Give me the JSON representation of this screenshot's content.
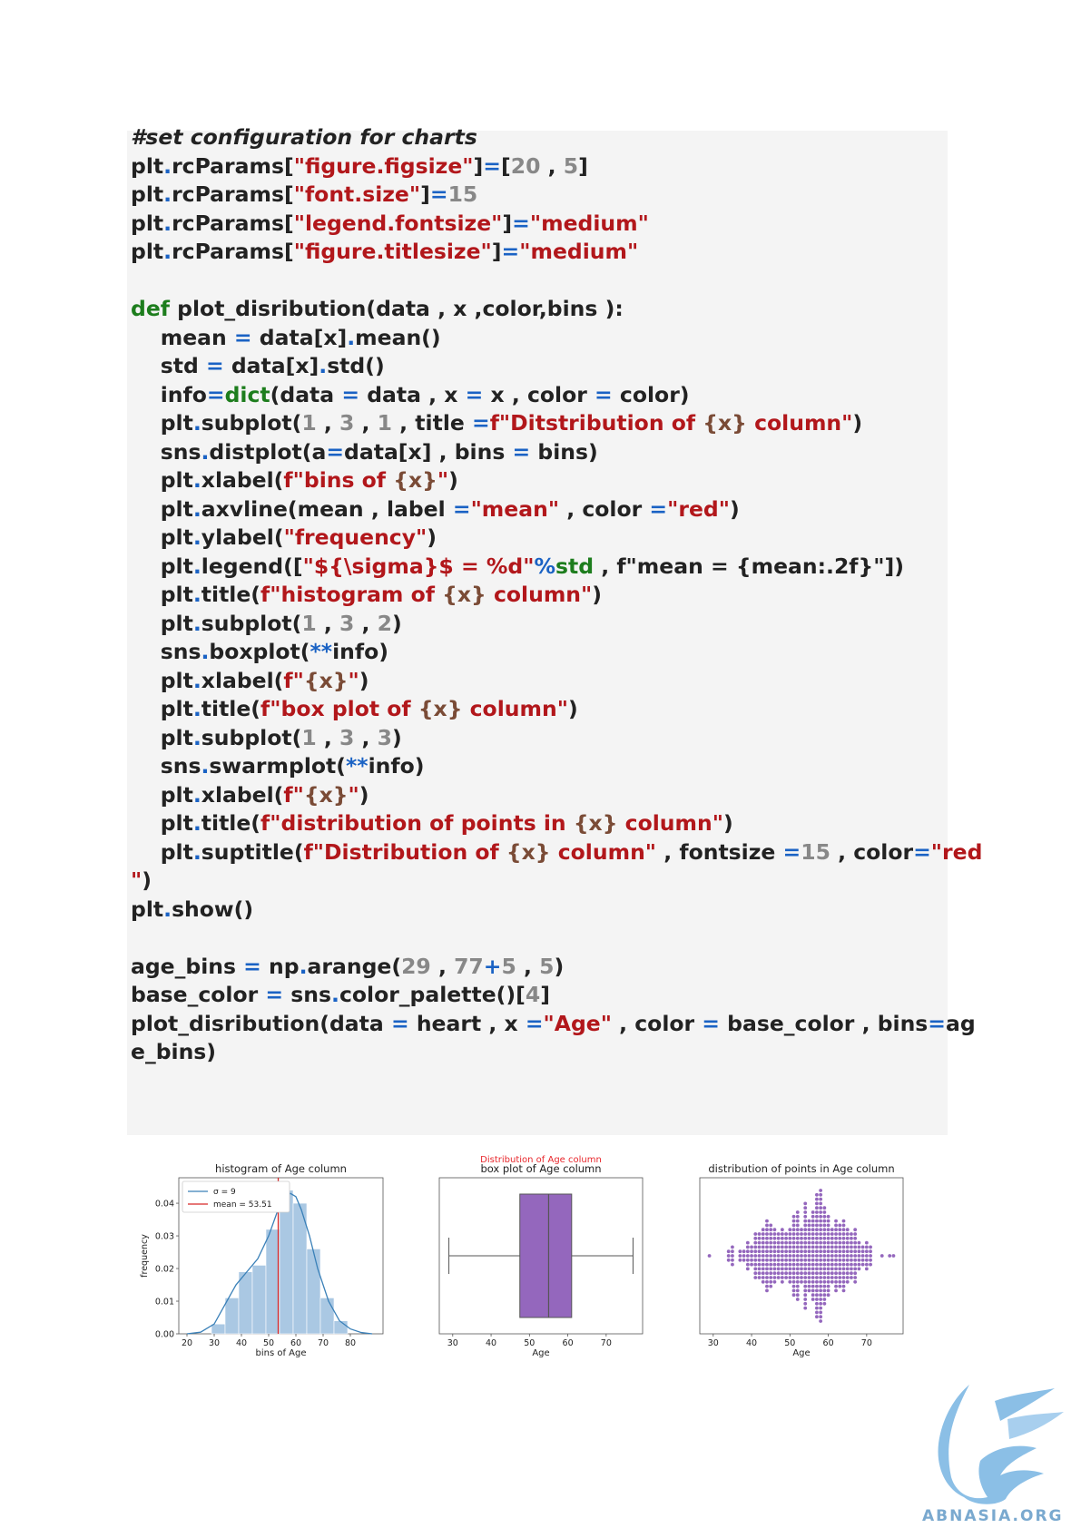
{
  "colors": {
    "code_default": "#222222",
    "code_keyword": "#1d7d1d",
    "code_string": "#b2171b",
    "code_number": "#888888",
    "code_operator": "#1a62c4",
    "code_fstring_brace": "#7a4b36",
    "code_block_bg": "#f4f4f4",
    "hist_fill": "#aac8e3",
    "kde_line": "#3a80b8",
    "mean_line": "#d62728",
    "box_fill": "#9467bd",
    "swarm_point": "#9467bd",
    "suptitle": "#e8262b",
    "logo": "#8bbfe6"
  },
  "code": {
    "lines": [
      [
        {
          "t": "#set configuration for charts",
          "c": "cm"
        }
      ],
      [
        {
          "t": "plt",
          "c": "d"
        },
        {
          "t": ".",
          "c": "o"
        },
        {
          "t": "rcParams[",
          "c": "d"
        },
        {
          "t": "\"figure.figsize\"",
          "c": "s"
        },
        {
          "t": "]",
          "c": "d"
        },
        {
          "t": "=",
          "c": "o"
        },
        {
          "t": "[",
          "c": "d"
        },
        {
          "t": "20",
          "c": "n"
        },
        {
          "t": " , ",
          "c": "d"
        },
        {
          "t": "5",
          "c": "n"
        },
        {
          "t": "]",
          "c": "d"
        }
      ],
      [
        {
          "t": "plt",
          "c": "d"
        },
        {
          "t": ".",
          "c": "o"
        },
        {
          "t": "rcParams[",
          "c": "d"
        },
        {
          "t": "\"font.size\"",
          "c": "s"
        },
        {
          "t": "]",
          "c": "d"
        },
        {
          "t": "=",
          "c": "o"
        },
        {
          "t": "15",
          "c": "n"
        }
      ],
      [
        {
          "t": "plt",
          "c": "d"
        },
        {
          "t": ".",
          "c": "o"
        },
        {
          "t": "rcParams[",
          "c": "d"
        },
        {
          "t": "\"legend.fontsize\"",
          "c": "s"
        },
        {
          "t": "]",
          "c": "d"
        },
        {
          "t": "=",
          "c": "o"
        },
        {
          "t": "\"medium\"",
          "c": "s"
        }
      ],
      [
        {
          "t": "plt",
          "c": "d"
        },
        {
          "t": ".",
          "c": "o"
        },
        {
          "t": "rcParams[",
          "c": "d"
        },
        {
          "t": "\"figure.titlesize\"",
          "c": "s"
        },
        {
          "t": "]",
          "c": "d"
        },
        {
          "t": "=",
          "c": "o"
        },
        {
          "t": "\"medium\"",
          "c": "s"
        }
      ],
      [],
      [
        {
          "t": "def",
          "c": "k"
        },
        {
          "t": " plot_disribution(data , x ,color,bins ):",
          "c": "d"
        }
      ],
      [
        {
          "t": "    mean ",
          "c": "d"
        },
        {
          "t": "=",
          "c": "o"
        },
        {
          "t": " data[x]",
          "c": "d"
        },
        {
          "t": ".",
          "c": "o"
        },
        {
          "t": "mean()",
          "c": "d"
        }
      ],
      [
        {
          "t": "    std ",
          "c": "d"
        },
        {
          "t": "=",
          "c": "o"
        },
        {
          "t": " data[x]",
          "c": "d"
        },
        {
          "t": ".",
          "c": "o"
        },
        {
          "t": "std()",
          "c": "d"
        }
      ],
      [
        {
          "t": "    info",
          "c": "d"
        },
        {
          "t": "=",
          "c": "o"
        },
        {
          "t": "dict",
          "c": "k"
        },
        {
          "t": "(data ",
          "c": "d"
        },
        {
          "t": "=",
          "c": "o"
        },
        {
          "t": " data , x ",
          "c": "d"
        },
        {
          "t": "=",
          "c": "o"
        },
        {
          "t": " x , color ",
          "c": "d"
        },
        {
          "t": "=",
          "c": "o"
        },
        {
          "t": " color)",
          "c": "d"
        }
      ],
      [
        {
          "t": "    plt",
          "c": "d"
        },
        {
          "t": ".",
          "c": "o"
        },
        {
          "t": "subplot(",
          "c": "d"
        },
        {
          "t": "1",
          "c": "n"
        },
        {
          "t": " , ",
          "c": "d"
        },
        {
          "t": "3",
          "c": "n"
        },
        {
          "t": " , ",
          "c": "d"
        },
        {
          "t": "1",
          "c": "n"
        },
        {
          "t": " , title ",
          "c": "d"
        },
        {
          "t": "=",
          "c": "o"
        },
        {
          "t": "f\"Ditstribution of ",
          "c": "s"
        },
        {
          "t": "{x}",
          "c": "b"
        },
        {
          "t": " column\"",
          "c": "s"
        },
        {
          "t": ")",
          "c": "d"
        }
      ],
      [
        {
          "t": "    sns",
          "c": "d"
        },
        {
          "t": ".",
          "c": "o"
        },
        {
          "t": "distplot(a",
          "c": "d"
        },
        {
          "t": "=",
          "c": "o"
        },
        {
          "t": "data[x] , bins ",
          "c": "d"
        },
        {
          "t": "=",
          "c": "o"
        },
        {
          "t": " bins)",
          "c": "d"
        }
      ],
      [
        {
          "t": "    plt",
          "c": "d"
        },
        {
          "t": ".",
          "c": "o"
        },
        {
          "t": "xlabel(",
          "c": "d"
        },
        {
          "t": "f\"bins of ",
          "c": "s"
        },
        {
          "t": "{x}",
          "c": "b"
        },
        {
          "t": "\"",
          "c": "s"
        },
        {
          "t": ")",
          "c": "d"
        }
      ],
      [
        {
          "t": "    plt",
          "c": "d"
        },
        {
          "t": ".",
          "c": "o"
        },
        {
          "t": "axvline(mean , label ",
          "c": "d"
        },
        {
          "t": "=",
          "c": "o"
        },
        {
          "t": "\"mean\"",
          "c": "s"
        },
        {
          "t": " , color ",
          "c": "d"
        },
        {
          "t": "=",
          "c": "o"
        },
        {
          "t": "\"red\"",
          "c": "s"
        },
        {
          "t": ")",
          "c": "d"
        }
      ],
      [
        {
          "t": "    plt",
          "c": "d"
        },
        {
          "t": ".",
          "c": "o"
        },
        {
          "t": "ylabel(",
          "c": "d"
        },
        {
          "t": "\"frequency\"",
          "c": "s"
        },
        {
          "t": ")",
          "c": "d"
        }
      ],
      [
        {
          "t": "    plt",
          "c": "d"
        },
        {
          "t": ".",
          "c": "o"
        },
        {
          "t": "legend([",
          "c": "d"
        },
        {
          "t": "\"${\\sigma}$ = %d\"",
          "c": "s"
        },
        {
          "t": "%",
          "c": "o"
        },
        {
          "t": "std",
          "c": "k"
        },
        {
          "t": " , f\"mean = {mean:.2f}\"])",
          "c": "d"
        }
      ],
      [
        {
          "t": "    plt",
          "c": "d"
        },
        {
          "t": ".",
          "c": "o"
        },
        {
          "t": "title(",
          "c": "d"
        },
        {
          "t": "f\"histogram of ",
          "c": "s"
        },
        {
          "t": "{x}",
          "c": "b"
        },
        {
          "t": " column\"",
          "c": "s"
        },
        {
          "t": ")",
          "c": "d"
        }
      ],
      [
        {
          "t": "    plt",
          "c": "d"
        },
        {
          "t": ".",
          "c": "o"
        },
        {
          "t": "subplot(",
          "c": "d"
        },
        {
          "t": "1",
          "c": "n"
        },
        {
          "t": " , ",
          "c": "d"
        },
        {
          "t": "3",
          "c": "n"
        },
        {
          "t": " , ",
          "c": "d"
        },
        {
          "t": "2",
          "c": "n"
        },
        {
          "t": ")",
          "c": "d"
        }
      ],
      [
        {
          "t": "    sns",
          "c": "d"
        },
        {
          "t": ".",
          "c": "o"
        },
        {
          "t": "boxplot(",
          "c": "d"
        },
        {
          "t": "**",
          "c": "o"
        },
        {
          "t": "info)",
          "c": "d"
        }
      ],
      [
        {
          "t": "    plt",
          "c": "d"
        },
        {
          "t": ".",
          "c": "o"
        },
        {
          "t": "xlabel(",
          "c": "d"
        },
        {
          "t": "f\"",
          "c": "s"
        },
        {
          "t": "{x}",
          "c": "b"
        },
        {
          "t": "\"",
          "c": "s"
        },
        {
          "t": ")",
          "c": "d"
        }
      ],
      [
        {
          "t": "    plt",
          "c": "d"
        },
        {
          "t": ".",
          "c": "o"
        },
        {
          "t": "title(",
          "c": "d"
        },
        {
          "t": "f\"box plot of ",
          "c": "s"
        },
        {
          "t": "{x}",
          "c": "b"
        },
        {
          "t": " column\"",
          "c": "s"
        },
        {
          "t": ")",
          "c": "d"
        }
      ],
      [
        {
          "t": "    plt",
          "c": "d"
        },
        {
          "t": ".",
          "c": "o"
        },
        {
          "t": "subplot(",
          "c": "d"
        },
        {
          "t": "1",
          "c": "n"
        },
        {
          "t": " , ",
          "c": "d"
        },
        {
          "t": "3",
          "c": "n"
        },
        {
          "t": " , ",
          "c": "d"
        },
        {
          "t": "3",
          "c": "n"
        },
        {
          "t": ")",
          "c": "d"
        }
      ],
      [
        {
          "t": "    sns",
          "c": "d"
        },
        {
          "t": ".",
          "c": "o"
        },
        {
          "t": "swarmplot(",
          "c": "d"
        },
        {
          "t": "**",
          "c": "o"
        },
        {
          "t": "info)",
          "c": "d"
        }
      ],
      [
        {
          "t": "    plt",
          "c": "d"
        },
        {
          "t": ".",
          "c": "o"
        },
        {
          "t": "xlabel(",
          "c": "d"
        },
        {
          "t": "f\"",
          "c": "s"
        },
        {
          "t": "{x}",
          "c": "b"
        },
        {
          "t": "\"",
          "c": "s"
        },
        {
          "t": ")",
          "c": "d"
        }
      ],
      [
        {
          "t": "    plt",
          "c": "d"
        },
        {
          "t": ".",
          "c": "o"
        },
        {
          "t": "title(",
          "c": "d"
        },
        {
          "t": "f\"distribution of points in ",
          "c": "s"
        },
        {
          "t": "{x}",
          "c": "b"
        },
        {
          "t": " column\"",
          "c": "s"
        },
        {
          "t": ")",
          "c": "d"
        }
      ],
      [
        {
          "t": "    plt",
          "c": "d"
        },
        {
          "t": ".",
          "c": "o"
        },
        {
          "t": "suptitle(",
          "c": "d"
        },
        {
          "t": "f\"Distribution of ",
          "c": "s"
        },
        {
          "t": "{x}",
          "c": "b"
        },
        {
          "t": " column\"",
          "c": "s"
        },
        {
          "t": " , fontsize ",
          "c": "d"
        },
        {
          "t": "=",
          "c": "o"
        },
        {
          "t": "15",
          "c": "n"
        },
        {
          "t": " , color",
          "c": "d"
        },
        {
          "t": "=",
          "c": "o"
        },
        {
          "t": "\"red",
          "c": "s"
        }
      ],
      [
        {
          "t": "\"",
          "c": "s"
        },
        {
          "t": ")",
          "c": "d"
        }
      ],
      [
        {
          "t": "plt",
          "c": "d"
        },
        {
          "t": ".",
          "c": "o"
        },
        {
          "t": "show()",
          "c": "d"
        }
      ],
      [],
      [
        {
          "t": "age_bins ",
          "c": "d"
        },
        {
          "t": "=",
          "c": "o"
        },
        {
          "t": " np",
          "c": "d"
        },
        {
          "t": ".",
          "c": "o"
        },
        {
          "t": "arange(",
          "c": "d"
        },
        {
          "t": "29",
          "c": "n"
        },
        {
          "t": " , ",
          "c": "d"
        },
        {
          "t": "77",
          "c": "n"
        },
        {
          "t": "+",
          "c": "o"
        },
        {
          "t": "5",
          "c": "n"
        },
        {
          "t": " , ",
          "c": "d"
        },
        {
          "t": "5",
          "c": "n"
        },
        {
          "t": ")",
          "c": "d"
        }
      ],
      [
        {
          "t": "base_color ",
          "c": "d"
        },
        {
          "t": "=",
          "c": "o"
        },
        {
          "t": " sns",
          "c": "d"
        },
        {
          "t": ".",
          "c": "o"
        },
        {
          "t": "color_palette()[",
          "c": "d"
        },
        {
          "t": "4",
          "c": "n"
        },
        {
          "t": "]",
          "c": "d"
        }
      ],
      [
        {
          "t": "plot_disribution(data ",
          "c": "d"
        },
        {
          "t": "=",
          "c": "o"
        },
        {
          "t": " heart , x ",
          "c": "d"
        },
        {
          "t": "=",
          "c": "o"
        },
        {
          "t": "\"Age\"",
          "c": "s"
        },
        {
          "t": " , color ",
          "c": "d"
        },
        {
          "t": "=",
          "c": "o"
        },
        {
          "t": " base_color , bins",
          "c": "d"
        },
        {
          "t": "=",
          "c": "o"
        },
        {
          "t": "ag",
          "c": "d"
        }
      ],
      [
        {
          "t": "e_bins)",
          "c": "d"
        }
      ]
    ]
  },
  "suptitle": "Distribution of Age column",
  "chart_data": [
    {
      "type": "bar",
      "title": "histogram of Age column",
      "xlabel": "bins of Age",
      "ylabel": "frequency",
      "xlim": [
        17,
        92
      ],
      "ylim": [
        0,
        0.0478
      ],
      "xticks": [
        20,
        30,
        40,
        50,
        60,
        70,
        80
      ],
      "yticks": [
        "0.00",
        "0.01",
        "0.02",
        "0.03",
        "0.04"
      ],
      "bin_edges": [
        29,
        34,
        39,
        44,
        49,
        54,
        59,
        64,
        69,
        74,
        79
      ],
      "values": [
        0.003,
        0.011,
        0.019,
        0.021,
        0.032,
        0.044,
        0.04,
        0.026,
        0.011,
        0.004
      ],
      "kde": {
        "x": [
          20,
          25,
          30,
          34,
          38,
          42,
          46,
          50,
          53,
          56,
          58,
          60,
          62,
          65,
          68,
          72,
          76,
          80,
          84,
          88
        ],
        "y": [
          0.0,
          0.0005,
          0.003,
          0.009,
          0.015,
          0.019,
          0.023,
          0.03,
          0.037,
          0.042,
          0.043,
          0.042,
          0.038,
          0.03,
          0.02,
          0.01,
          0.004,
          0.0015,
          0.0004,
          0.0
        ]
      },
      "mean_line": 53.51,
      "legend": {
        "placement": "upper-left",
        "entries": [
          "σ = 9",
          "mean = 53.51"
        ]
      }
    },
    {
      "type": "box",
      "title": "box plot of Age column",
      "xlabel": "Age",
      "xlim": [
        26.5,
        79.5
      ],
      "xticks": [
        30,
        40,
        50,
        60,
        70
      ],
      "whisker_low": 29,
      "q1": 47.5,
      "median": 55,
      "q3": 61,
      "whisker_high": 77
    },
    {
      "type": "swarm",
      "title": "distribution of points in Age column",
      "xlabel": "Age",
      "xlim": [
        26.5,
        79.5
      ],
      "xticks": [
        30,
        40,
        50,
        60,
        70
      ],
      "value_range": [
        29,
        77
      ],
      "densities": [
        {
          "age": 29,
          "count": 1
        },
        {
          "age": 34,
          "count": 3
        },
        {
          "age": 35,
          "count": 5
        },
        {
          "age": 37,
          "count": 3
        },
        {
          "age": 38,
          "count": 3
        },
        {
          "age": 39,
          "count": 7
        },
        {
          "age": 40,
          "count": 5
        },
        {
          "age": 41,
          "count": 11
        },
        {
          "age": 42,
          "count": 11
        },
        {
          "age": 43,
          "count": 13
        },
        {
          "age": 44,
          "count": 17
        },
        {
          "age": 45,
          "count": 15
        },
        {
          "age": 46,
          "count": 13
        },
        {
          "age": 47,
          "count": 11
        },
        {
          "age": 48,
          "count": 13
        },
        {
          "age": 49,
          "count": 11
        },
        {
          "age": 50,
          "count": 13
        },
        {
          "age": 51,
          "count": 19
        },
        {
          "age": 52,
          "count": 21
        },
        {
          "age": 53,
          "count": 13
        },
        {
          "age": 54,
          "count": 25
        },
        {
          "age": 55,
          "count": 17
        },
        {
          "age": 56,
          "count": 21
        },
        {
          "age": 57,
          "count": 29
        },
        {
          "age": 58,
          "count": 31
        },
        {
          "age": 59,
          "count": 23
        },
        {
          "age": 60,
          "count": 19
        },
        {
          "age": 61,
          "count": 13
        },
        {
          "age": 62,
          "count": 17
        },
        {
          "age": 63,
          "count": 15
        },
        {
          "age": 64,
          "count": 17
        },
        {
          "age": 65,
          "count": 13
        },
        {
          "age": 66,
          "count": 11
        },
        {
          "age": 67,
          "count": 13
        },
        {
          "age": 68,
          "count": 7
        },
        {
          "age": 69,
          "count": 5
        },
        {
          "age": 70,
          "count": 7
        },
        {
          "age": 71,
          "count": 5
        },
        {
          "age": 74,
          "count": 1
        },
        {
          "age": 76,
          "count": 1
        },
        {
          "age": 77,
          "count": 1
        }
      ]
    }
  ],
  "logo": {
    "text": "ABNASIA.ORG"
  }
}
